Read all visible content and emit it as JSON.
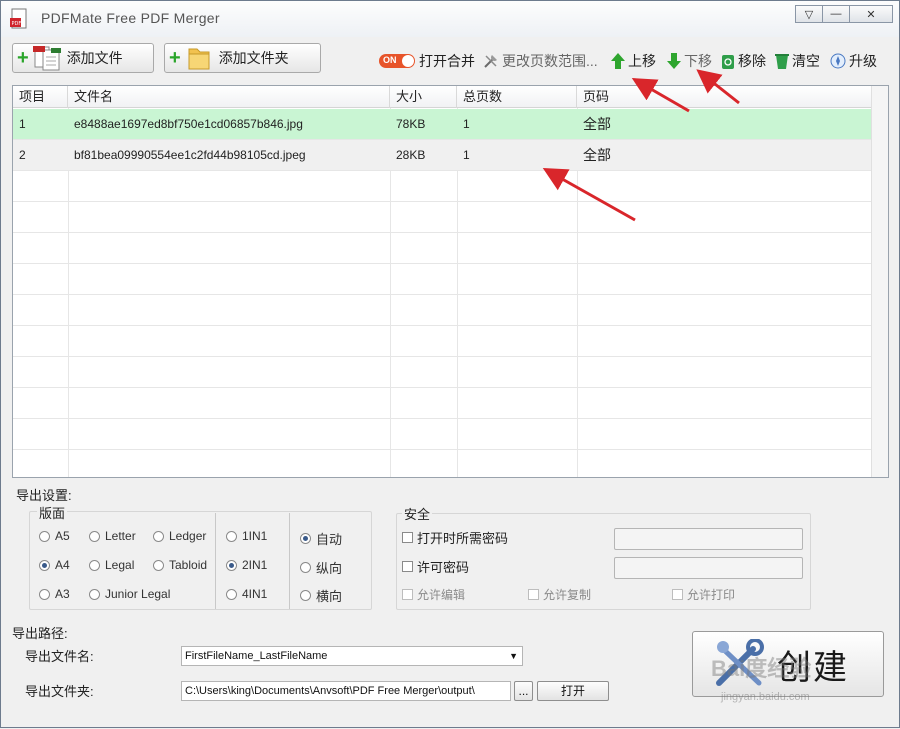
{
  "window": {
    "title": "PDFMate Free PDF Merger",
    "controls": {
      "dropdown": "▽",
      "minimize": "—",
      "close": "✕"
    }
  },
  "toolbar": {
    "add_file": "添加文件",
    "add_folder": "添加文件夹",
    "toggle_label": "ON",
    "open_merge": "打开合并",
    "change_range": "更改页数范围...",
    "move_up": "上移",
    "move_down": "下移",
    "remove": "移除",
    "clear": "清空",
    "upgrade": "升级"
  },
  "table": {
    "headers": [
      "项目",
      "文件名",
      "大小",
      "总页数",
      "页码"
    ],
    "rows": [
      {
        "index": "1",
        "filename": "e8488ae1697ed8bf750e1cd06857b846.jpg",
        "size": "78KB",
        "pages": "1",
        "range": "全部"
      },
      {
        "index": "2",
        "filename": "bf81bea09990554ee1c2fd44b98105cd.jpeg",
        "size": "28KB",
        "pages": "1",
        "range": "全部"
      }
    ]
  },
  "export": {
    "settings_label": "导出设置:",
    "layout_label": "版面",
    "paper": {
      "a5": "A5",
      "a4": "A4",
      "a3": "A3",
      "letter": "Letter",
      "legal": "Legal",
      "junior": "Junior Legal",
      "ledger": "Ledger",
      "tabloid": "Tabloid"
    },
    "nup": {
      "one": "1IN1",
      "two": "2IN1",
      "four": "4IN1"
    },
    "orientation": {
      "auto": "自动",
      "portrait": "纵向",
      "landscape": "横向"
    },
    "selected": {
      "paper": "A4",
      "nup": "2IN1",
      "orientation": "自动"
    }
  },
  "security": {
    "label": "安全",
    "open_password": "打开时所需密码",
    "permission_password": "许可密码",
    "allow_edit": "允许编辑",
    "allow_copy": "允许复制",
    "allow_print": "允许打印"
  },
  "output": {
    "path_label": "导出路径:",
    "filename_label": "导出文件名:",
    "filename_value": "FirstFileName_LastFileName",
    "folder_label": "导出文件夹:",
    "folder_value": "C:\\Users\\king\\Documents\\Anvsoft\\PDF Free Merger\\output\\",
    "browse": "...",
    "open": "打开",
    "create": "创建"
  },
  "watermark": {
    "main": "Bai度经验",
    "sub": "jingyan.baidu.com"
  },
  "colors": {
    "selected_row": "#c9f5d3",
    "toggle": "#e7542a",
    "arrow": "#d9262b",
    "green": "#2aa52a"
  }
}
